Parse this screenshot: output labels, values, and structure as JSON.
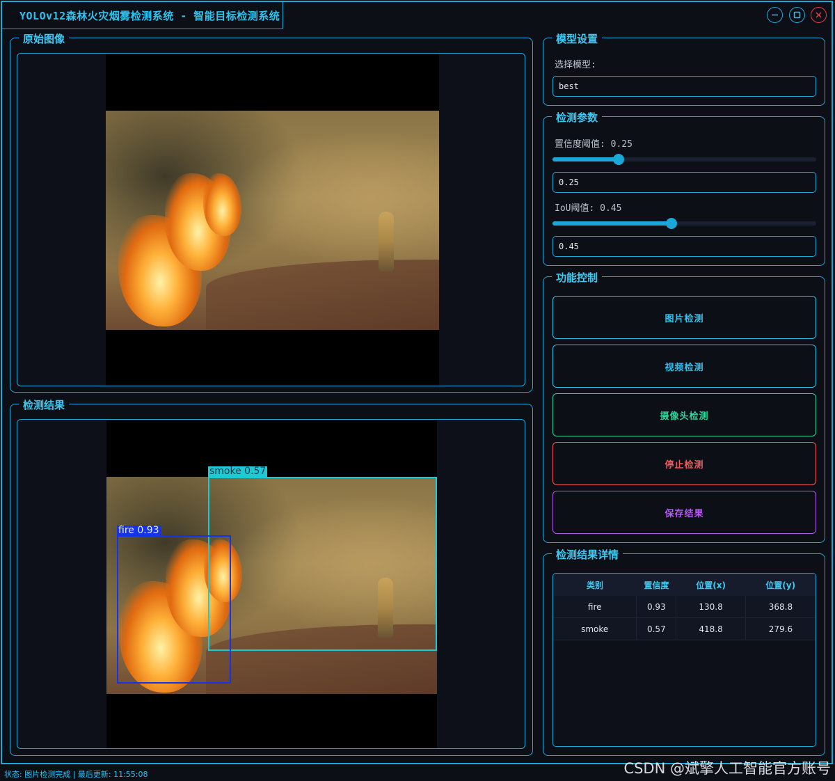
{
  "window": {
    "title": "YOLOv12森林火灾烟雾检测系统 - 智能目标检测系统",
    "buttons": {
      "minimize": "minimize-icon",
      "maximize": "maximize-icon",
      "close": "close-icon"
    }
  },
  "panels": {
    "original": {
      "title": "原始图像"
    },
    "result": {
      "title": "检测结果"
    }
  },
  "detections": [
    {
      "label": "smoke 0.57",
      "color": "#1ec9d6"
    },
    {
      "label": "fire 0.93",
      "color": "#1733e8"
    }
  ],
  "model_settings": {
    "title": "模型设置",
    "select_label": "选择模型:",
    "model_value": "best"
  },
  "detect_params": {
    "title": "检测参数",
    "conf_label": "置信度阈值: 0.25",
    "conf_value": "0.25",
    "conf_level": 0.25,
    "iou_label": "IoU阈值: 0.45",
    "iou_value": "0.45",
    "iou_level": 0.45
  },
  "controls": {
    "title": "功能控制",
    "buttons": [
      {
        "label": "图片检测",
        "color": "#2ec3ef"
      },
      {
        "label": "视频检测",
        "color": "#2ec3ef"
      },
      {
        "label": "摄像头检测",
        "color": "#2fd39a"
      },
      {
        "label": "停止检测",
        "color": "#f05a5a"
      },
      {
        "label": "保存结果",
        "color": "#b45cf0"
      }
    ]
  },
  "details": {
    "title": "检测结果详情",
    "columns": [
      "类别",
      "置信度",
      "位置(x)",
      "位置(y)"
    ],
    "rows": [
      [
        "fire",
        "0.93",
        "130.8",
        "368.8"
      ],
      [
        "smoke",
        "0.57",
        "418.8",
        "279.6"
      ]
    ]
  },
  "status": {
    "text": "状态: 图片检测完成 | 最后更新: 11:55:08"
  },
  "watermark": {
    "text": "CSDN @斌擎人工智能官方账号"
  }
}
